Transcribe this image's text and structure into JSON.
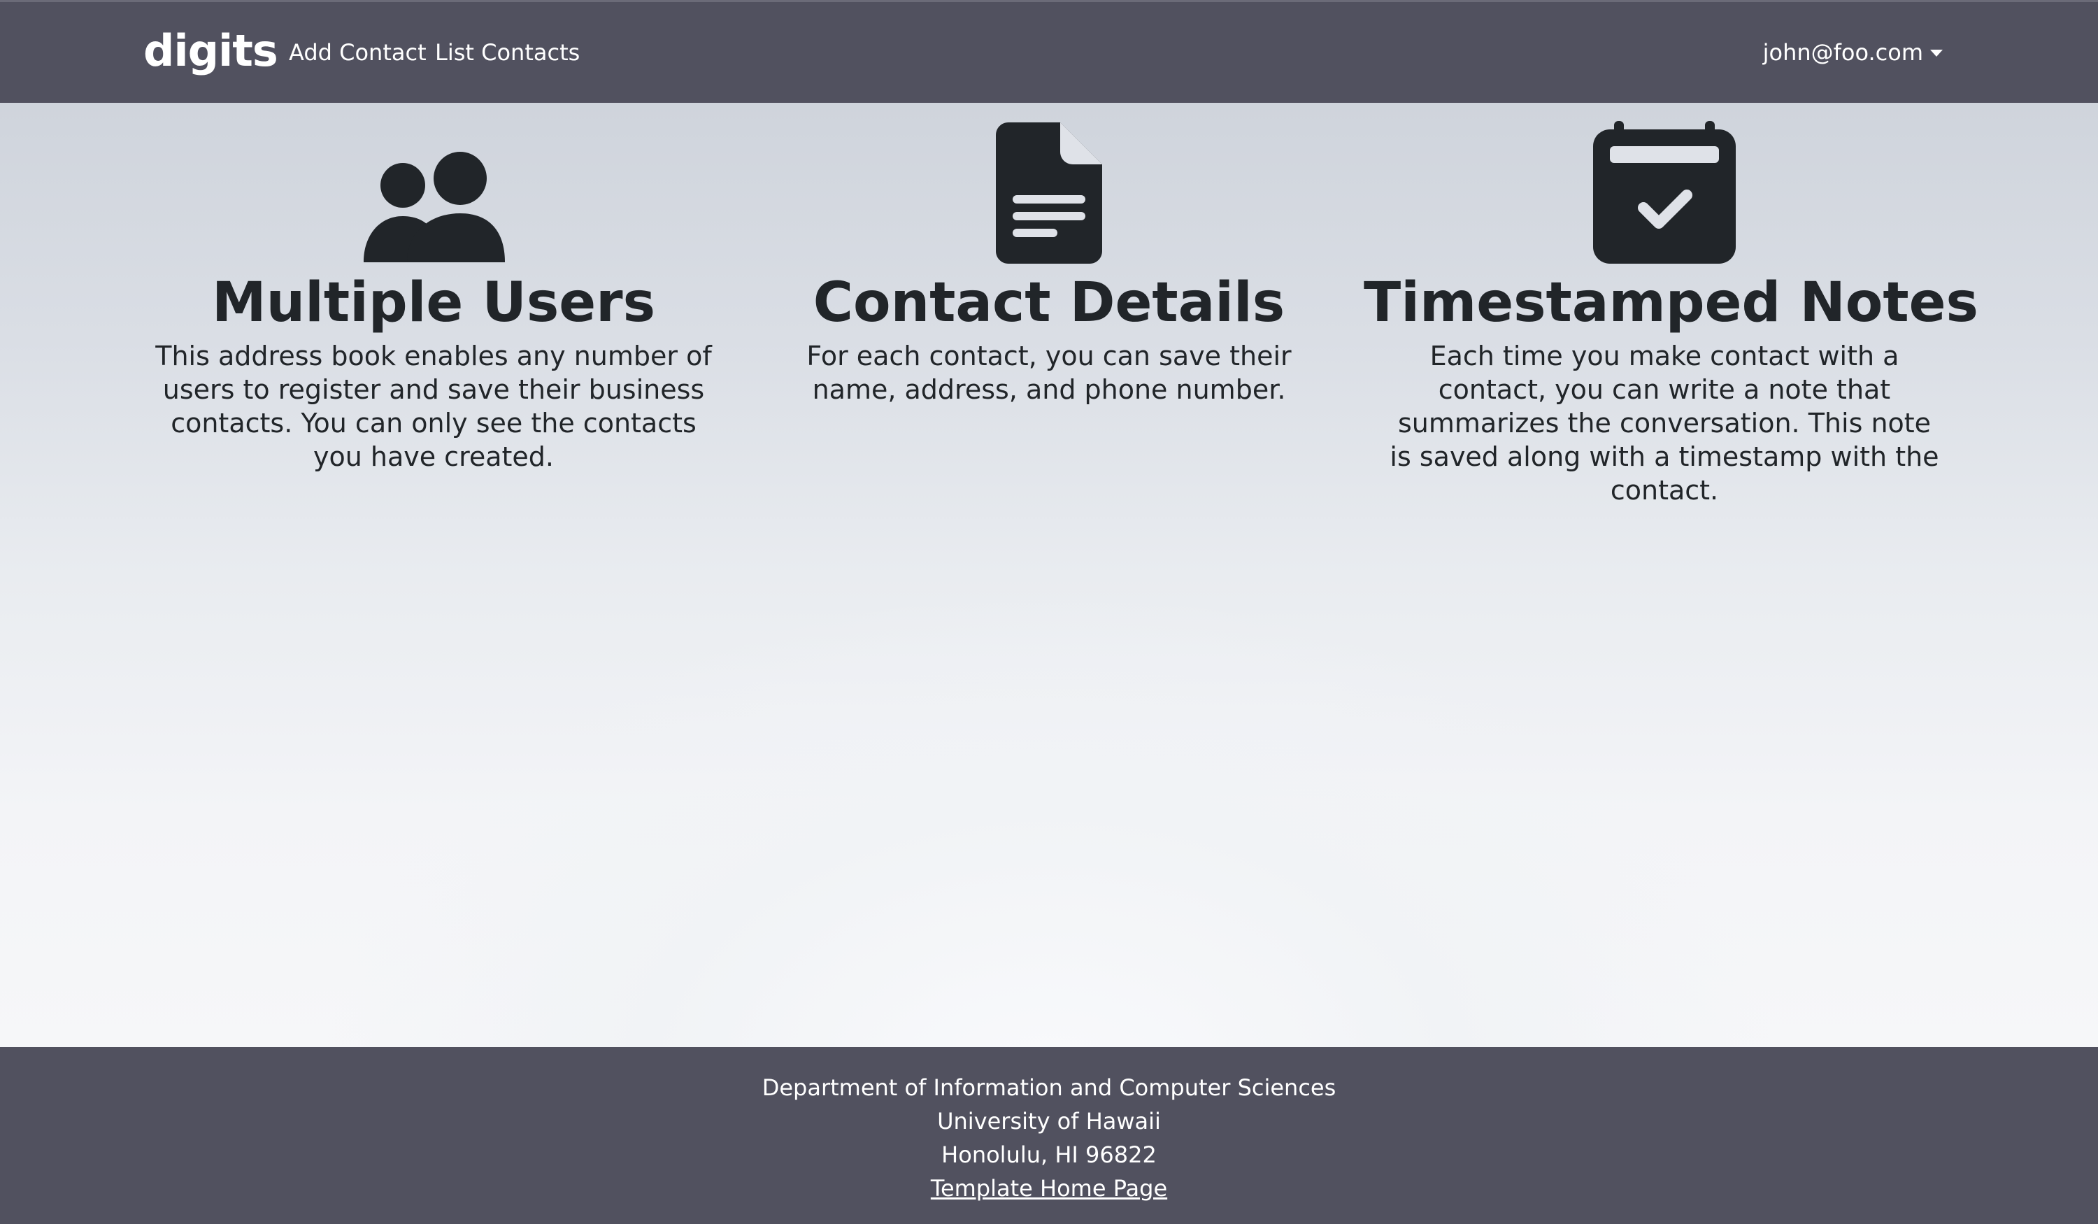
{
  "navbar": {
    "brand": "digits",
    "links": [
      {
        "label": "Add Contact"
      },
      {
        "label": "List Contacts"
      }
    ],
    "user": "john@foo.com"
  },
  "features": [
    {
      "icon": "users-icon",
      "title": "Multiple Users",
      "description": "This address book enables any number of users to register and save their business contacts. You can only see the contacts you have created."
    },
    {
      "icon": "file-lines-icon",
      "title": "Contact Details",
      "description": "For each contact, you can save their name, address, and phone number."
    },
    {
      "icon": "calendar-check-icon",
      "title": "Timestamped Notes",
      "description": "Each time you make contact with a contact, you can write a note that summarizes the conversation. This note is saved along with a timestamp with the contact."
    }
  ],
  "footer": {
    "line1": "Department of Information and Computer Sciences",
    "line2": "University of Hawaii",
    "line3": "Honolulu, HI 96822",
    "link": "Template Home Page"
  },
  "colors": {
    "navbar_bg": "#51515f",
    "text_dark": "#212529",
    "icon_fill": "#212529"
  }
}
